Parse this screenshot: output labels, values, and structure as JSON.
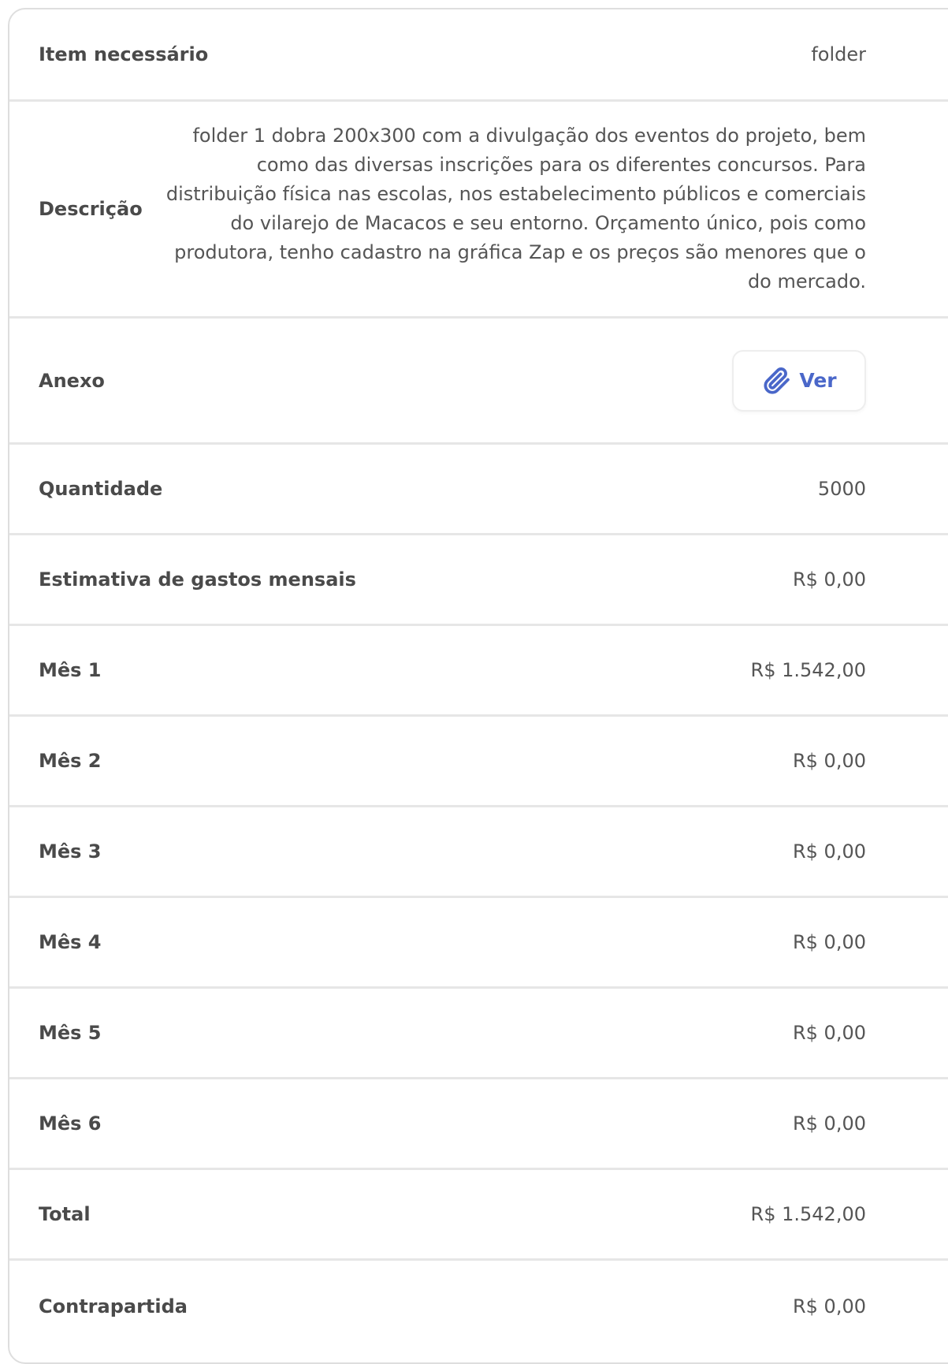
{
  "rows": {
    "item": {
      "label": "Item necessário",
      "value": "folder"
    },
    "descricao": {
      "label": "Descrição",
      "value": "folder 1 dobra 200x300 com a divulgação dos eventos do projeto, bem como das diversas inscrições para os diferentes concursos. Para distribuição física nas escolas, nos estabelecimento públicos e comerciais do vilarejo de Macacos e seu entorno. Orçamento único, pois como produtora, tenho cadastro na gráfica Zap e os preços são menores que o do mercado."
    },
    "anexo": {
      "label": "Anexo",
      "button_label": "Ver",
      "icon": "paperclip-icon"
    },
    "quantidade": {
      "label": "Quantidade",
      "value": "5000"
    },
    "estimativa": {
      "label": "Estimativa de gastos mensais",
      "value": "R$ 0,00"
    },
    "mes1": {
      "label": "Mês 1",
      "value": "R$ 1.542,00"
    },
    "mes2": {
      "label": "Mês 2",
      "value": "R$ 0,00"
    },
    "mes3": {
      "label": "Mês 3",
      "value": "R$ 0,00"
    },
    "mes4": {
      "label": "Mês 4",
      "value": "R$ 0,00"
    },
    "mes5": {
      "label": "Mês 5",
      "value": "R$ 0,00"
    },
    "mes6": {
      "label": "Mês 6",
      "value": "R$ 0,00"
    },
    "total": {
      "label": "Total",
      "value": "R$ 1.542,00"
    },
    "contrapartida": {
      "label": "Contrapartida",
      "value": "R$ 0,00"
    }
  },
  "colors": {
    "accent": "#4a67c9",
    "text": "#4a4a4a",
    "divider": "#e6e6e6"
  }
}
